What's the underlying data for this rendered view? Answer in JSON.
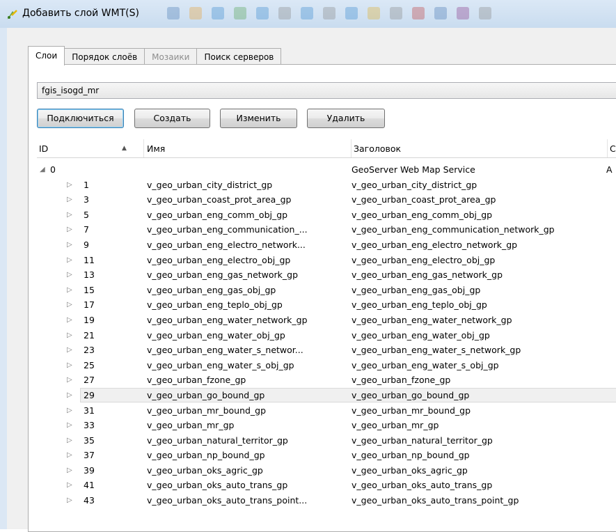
{
  "window": {
    "title": "Добавить слой WMT(S)"
  },
  "tabs": [
    {
      "label": "Слои",
      "active": true
    },
    {
      "label": "Порядок слоёв",
      "active": false
    },
    {
      "label": "Мозаики",
      "active": false,
      "disabled": true
    },
    {
      "label": "Поиск серверов",
      "active": false
    }
  ],
  "connection": {
    "selected": "fgis_isogd_mr"
  },
  "buttons": {
    "connect": "Подключиться",
    "create": "Создать",
    "edit": "Изменить",
    "delete": "Удалить"
  },
  "table": {
    "headers": {
      "id": "ID",
      "name": "Имя",
      "title": "Заголовок",
      "extra": "С"
    },
    "root": {
      "id": "0",
      "title": "GeoServer Web Map Service",
      "extra": "А"
    },
    "rows": [
      {
        "id": "1",
        "name": "v_geo_urban_city_district_gp",
        "title": "v_geo_urban_city_district_gp"
      },
      {
        "id": "3",
        "name": "v_geo_urban_coast_prot_area_gp",
        "title": "v_geo_urban_coast_prot_area_gp"
      },
      {
        "id": "5",
        "name": "v_geo_urban_eng_comm_obj_gp",
        "title": "v_geo_urban_eng_comm_obj_gp"
      },
      {
        "id": "7",
        "name": "v_geo_urban_eng_communication_...",
        "title": "v_geo_urban_eng_communication_network_gp"
      },
      {
        "id": "9",
        "name": "v_geo_urban_eng_electro_network...",
        "title": "v_geo_urban_eng_electro_network_gp"
      },
      {
        "id": "11",
        "name": "v_geo_urban_eng_electro_obj_gp",
        "title": "v_geo_urban_eng_electro_obj_gp"
      },
      {
        "id": "13",
        "name": "v_geo_urban_eng_gas_network_gp",
        "title": "v_geo_urban_eng_gas_network_gp"
      },
      {
        "id": "15",
        "name": "v_geo_urban_eng_gas_obj_gp",
        "title": "v_geo_urban_eng_gas_obj_gp"
      },
      {
        "id": "17",
        "name": "v_geo_urban_eng_teplo_obj_gp",
        "title": "v_geo_urban_eng_teplo_obj_gp"
      },
      {
        "id": "19",
        "name": "v_geo_urban_eng_water_network_gp",
        "title": "v_geo_urban_eng_water_network_gp"
      },
      {
        "id": "21",
        "name": "v_geo_urban_eng_water_obj_gp",
        "title": "v_geo_urban_eng_water_obj_gp"
      },
      {
        "id": "23",
        "name": "v_geo_urban_eng_water_s_networ...",
        "title": "v_geo_urban_eng_water_s_network_gp"
      },
      {
        "id": "25",
        "name": "v_geo_urban_eng_water_s_obj_gp",
        "title": "v_geo_urban_eng_water_s_obj_gp"
      },
      {
        "id": "27",
        "name": "v_geo_urban_fzone_gp",
        "title": "v_geo_urban_fzone_gp"
      },
      {
        "id": "29",
        "name": "v_geo_urban_go_bound_gp",
        "title": "v_geo_urban_go_bound_gp",
        "selected": true
      },
      {
        "id": "31",
        "name": "v_geo_urban_mr_bound_gp",
        "title": "v_geo_urban_mr_bound_gp"
      },
      {
        "id": "33",
        "name": "v_geo_urban_mr_gp",
        "title": "v_geo_urban_mr_gp"
      },
      {
        "id": "35",
        "name": "v_geo_urban_natural_territor_gp",
        "title": "v_geo_urban_natural_territor_gp"
      },
      {
        "id": "37",
        "name": "v_geo_urban_np_bound_gp",
        "title": "v_geo_urban_np_bound_gp"
      },
      {
        "id": "39",
        "name": "v_geo_urban_oks_agric_gp",
        "title": "v_geo_urban_oks_agric_gp"
      },
      {
        "id": "41",
        "name": "v_geo_urban_oks_auto_trans_gp",
        "title": "v_geo_urban_oks_auto_trans_gp"
      },
      {
        "id": "43",
        "name": "v_geo_urban_oks_auto_trans_point...",
        "title": "v_geo_urban_oks_auto_trans_point_gp"
      }
    ]
  }
}
